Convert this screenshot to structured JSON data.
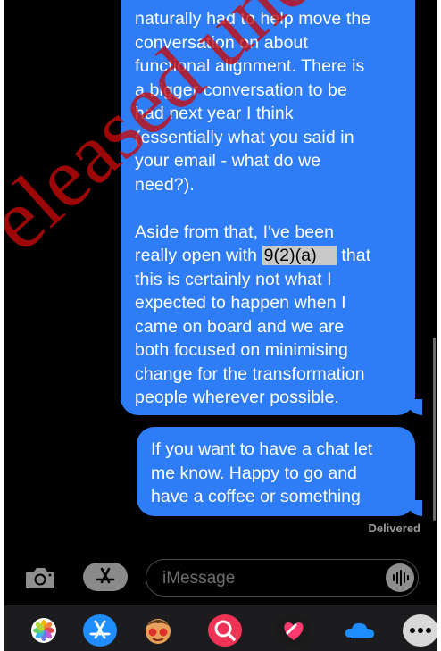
{
  "conversation": {
    "message_1": {
      "lines": [
        "naturally had to help move the",
        "conversation on about",
        "functional alignment. There is",
        "a bigger conversation to be",
        "had next year I think",
        "(essentially what you said in",
        "your email - what do we",
        "need?).",
        "",
        "Aside from that, I've been"
      ],
      "redacted_line_prefix": "really open with ",
      "redaction_label": "9(2)(a)",
      "redacted_line_suffix": " that",
      "lines_after": [
        "this is certainly not what I",
        "expected to happen when I",
        "came on board and we are",
        "both focused on minimising",
        "change for the transformation",
        "people wherever possible."
      ]
    },
    "message_2": {
      "lines": [
        "If you want to have a chat let",
        "me know. Happy to go and",
        "have a coffee or something"
      ]
    },
    "delivery_status": "Delivered"
  },
  "composer": {
    "placeholder": "iMessage",
    "camera_icon": "camera-icon",
    "apps_icon": "app-store-icon",
    "audio_icon": "audio-waveform-icon"
  },
  "dock": {
    "apps": [
      "photos-icon",
      "app-store-icon",
      "memoji-icon",
      "image-search-icon",
      "digital-touch-icon",
      "cloud-icon",
      "more-icon"
    ]
  },
  "watermark": "eleased under the",
  "colors": {
    "bubble": "#2f7df6",
    "background": "#000000",
    "watermark": "#c80a0a"
  }
}
